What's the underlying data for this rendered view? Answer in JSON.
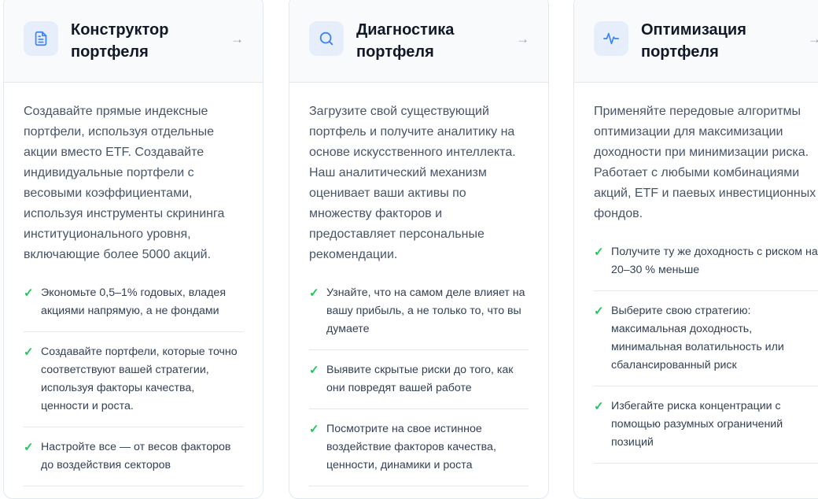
{
  "cards": [
    {
      "icon": "document-icon",
      "title": "Конструктор портфеля",
      "arrow": "→",
      "description": "Создавайте прямые индексные портфели, используя отдельные акции вместо ETF. Создавайте индивидуальные портфели с весовыми коэффициентами, используя инструменты скрининга институционального уровня, включающие более 5000 акций.",
      "features": [
        "Экономьте 0,5–1% годовых, владея акциями напрямую, а не фондами",
        "Создавайте портфели, которые точно соответствуют вашей стратегии, используя факторы качества, ценности и роста.",
        "Настройте все — от весов факторов до воздействия секторов"
      ]
    },
    {
      "icon": "search-icon",
      "title": "Диагностика портфеля",
      "arrow": "→",
      "description": "Загрузите свой существующий портфель и получите аналитику на основе искусственного интеллекта. Наш аналитический механизм оценивает ваши активы по множеству факторов и предоставляет персональные рекомендации.",
      "features": [
        "Узнайте, что на самом деле влияет на вашу прибыль, а не только то, что вы думаете",
        "Выявите скрытые риски до того, как они повредят вашей работе",
        "Посмотрите на свое истинное воздействие факторов качества, ценности, динамики и роста"
      ]
    },
    {
      "icon": "activity-icon",
      "title": "Оптимизация портфеля",
      "arrow": "→",
      "description": "Применяйте передовые алгоритмы оптимизации для максимизации доходности при минимизации риска. Работает с любыми комбинациями акций, ETF и паевых инвестиционных фондов.",
      "features": [
        "Получите ту же доходность с риском на 20–30 % меньше",
        "Выберите свою стратегию: максимальная доходность, минимальная волатильность или сбалансированный риск",
        "Избегайте риска концентрации с помощью разумных ограничений позиций"
      ]
    }
  ],
  "check_glyph": "✓",
  "colors": {
    "accent": "#3b82f6",
    "icon_bg": "#e6eefb",
    "check": "#22c55e",
    "header_bg": "#f8fafc"
  }
}
